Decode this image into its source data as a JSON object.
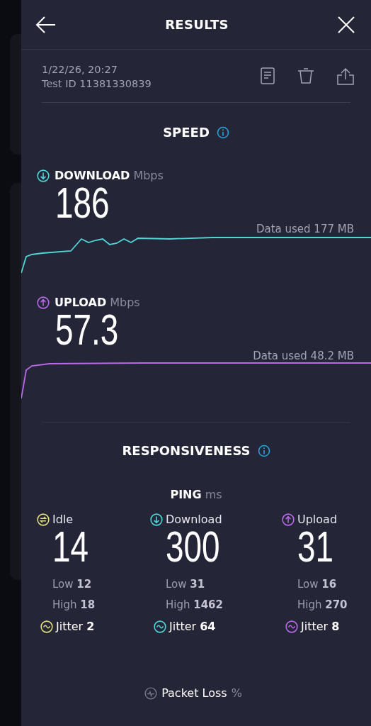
{
  "header": {
    "title": "RESULTS"
  },
  "test": {
    "datetime": "1/22/26, 20:27",
    "test_id": "Test ID 11381330839"
  },
  "speed": {
    "title": "SPEED",
    "metrics": [
      {
        "kind": "download",
        "label": "DOWNLOAD",
        "unit": "Mbps",
        "value": "186",
        "data_used": "Data used 177 MB",
        "color": "#4fd6d6"
      },
      {
        "kind": "upload",
        "label": "UPLOAD",
        "unit": "Mbps",
        "value": "57.3",
        "data_used": "Data used 48.2 MB",
        "color": "#b86ae8"
      }
    ]
  },
  "responsiveness": {
    "title": "RESPONSIVENESS",
    "ping": {
      "label": "PING",
      "unit": "ms",
      "columns": [
        {
          "kind": "idle",
          "label": "Idle",
          "value": "14",
          "low": "Low **12**",
          "high": "High **18**",
          "jitter": "Jitter **2**",
          "color": "#e3df7c"
        },
        {
          "kind": "download",
          "label": "Download",
          "value": "300",
          "low": "Low **31**",
          "high": "High **1462**",
          "jitter": "Jitter **64**",
          "color": "#4fd6d6"
        },
        {
          "kind": "upload",
          "label": "Upload",
          "value": "31",
          "low": "Low **16**",
          "high": "High **270**",
          "jitter": "Jitter **8**",
          "color": "#b86ae8"
        }
      ]
    },
    "packet_loss": {
      "label": "Packet Loss",
      "unit": "%"
    }
  }
}
